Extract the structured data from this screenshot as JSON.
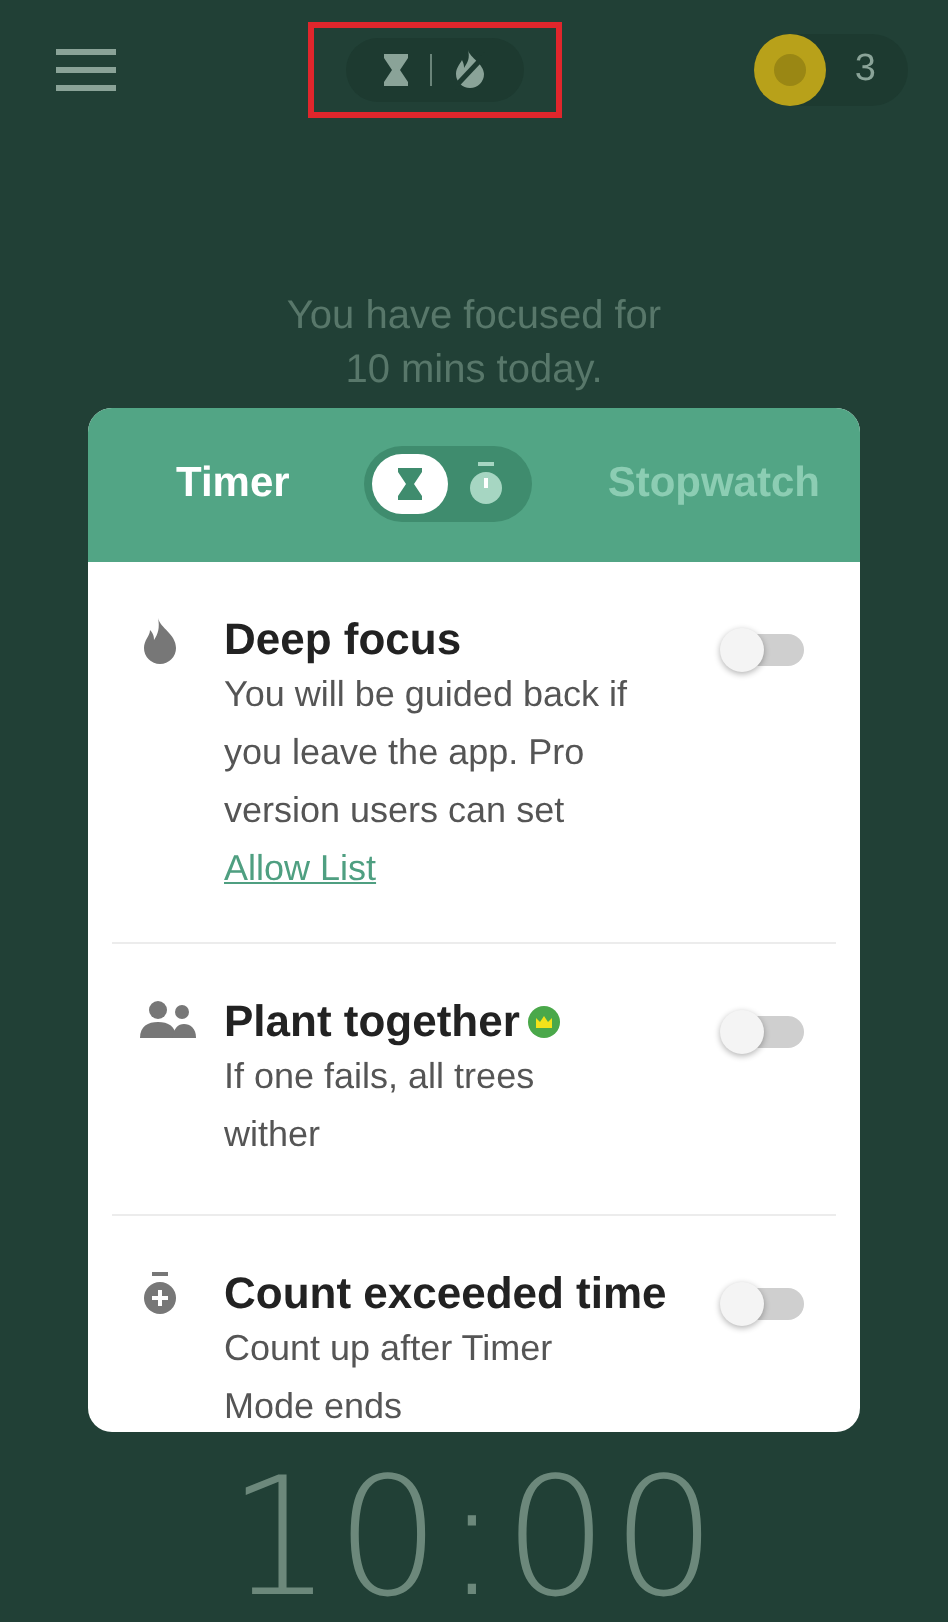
{
  "header": {
    "coins": "3"
  },
  "focus_message": "You have focused for 10 mins today.",
  "timer": "10:00",
  "mode_card": {
    "modes": [
      {
        "kind": "timer",
        "label": "Timer",
        "selected": true
      },
      {
        "kind": "stopwatch",
        "label": "Stopwatch",
        "selected": false
      }
    ],
    "options": [
      {
        "kind": "flame",
        "title": "Deep focus",
        "pro": false,
        "description": "You will be guided back if you leave the app. Pro version users can set",
        "link": "Allow List",
        "on": false
      },
      {
        "kind": "people",
        "title": "Plant together",
        "pro": true,
        "description": "If one fails, all trees wither",
        "on": false
      },
      {
        "kind": "stopwatch-plus",
        "title": "Count exceeded time",
        "pro": false,
        "description": "Count up after Timer Mode ends",
        "on": false
      }
    ]
  }
}
